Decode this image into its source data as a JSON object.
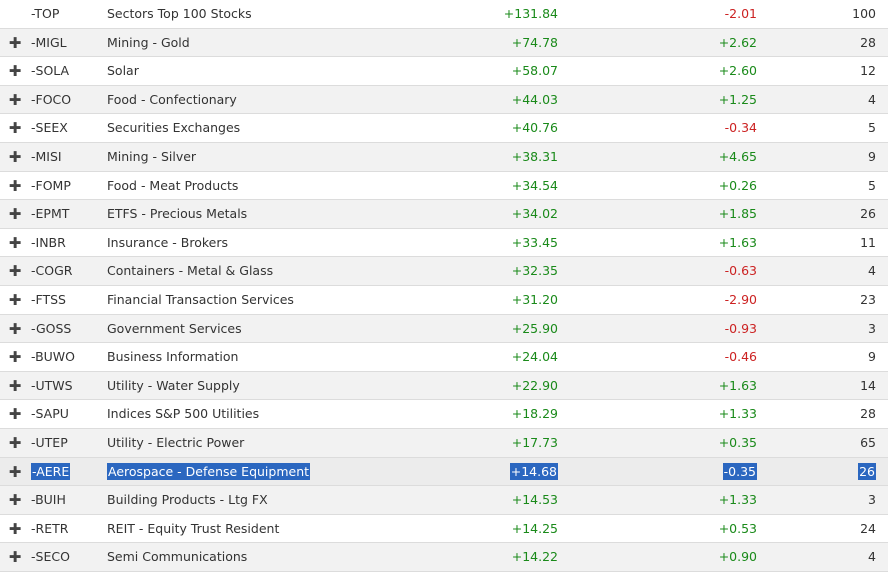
{
  "rows": [
    {
      "symbol": "-TOP",
      "name": "Sectors Top 100 Stocks",
      "change": "+131.84",
      "change2": "-2.01",
      "count": "100",
      "expand": false,
      "selected": false
    },
    {
      "symbol": "-MIGL",
      "name": "Mining - Gold",
      "change": "+74.78",
      "change2": "+2.62",
      "count": "28",
      "expand": true,
      "selected": false
    },
    {
      "symbol": "-SOLA",
      "name": "Solar",
      "change": "+58.07",
      "change2": "+2.60",
      "count": "12",
      "expand": true,
      "selected": false
    },
    {
      "symbol": "-FOCO",
      "name": "Food - Confectionary",
      "change": "+44.03",
      "change2": "+1.25",
      "count": "4",
      "expand": true,
      "selected": false
    },
    {
      "symbol": "-SEEX",
      "name": "Securities Exchanges",
      "change": "+40.76",
      "change2": "-0.34",
      "count": "5",
      "expand": true,
      "selected": false
    },
    {
      "symbol": "-MISI",
      "name": "Mining - Silver",
      "change": "+38.31",
      "change2": "+4.65",
      "count": "9",
      "expand": true,
      "selected": false
    },
    {
      "symbol": "-FOMP",
      "name": "Food - Meat Products",
      "change": "+34.54",
      "change2": "+0.26",
      "count": "5",
      "expand": true,
      "selected": false
    },
    {
      "symbol": "-EPMT",
      "name": "ETFS - Precious Metals",
      "change": "+34.02",
      "change2": "+1.85",
      "count": "26",
      "expand": true,
      "selected": false
    },
    {
      "symbol": "-INBR",
      "name": "Insurance - Brokers",
      "change": "+33.45",
      "change2": "+1.63",
      "count": "11",
      "expand": true,
      "selected": false
    },
    {
      "symbol": "-COGR",
      "name": "Containers - Metal & Glass",
      "change": "+32.35",
      "change2": "-0.63",
      "count": "4",
      "expand": true,
      "selected": false
    },
    {
      "symbol": "-FTSS",
      "name": "Financial Transaction Services",
      "change": "+31.20",
      "change2": "-2.90",
      "count": "23",
      "expand": true,
      "selected": false
    },
    {
      "symbol": "-GOSS",
      "name": "Government Services",
      "change": "+25.90",
      "change2": "-0.93",
      "count": "3",
      "expand": true,
      "selected": false
    },
    {
      "symbol": "-BUWO",
      "name": "Business Information",
      "change": "+24.04",
      "change2": "-0.46",
      "count": "9",
      "expand": true,
      "selected": false
    },
    {
      "symbol": "-UTWS",
      "name": "Utility - Water Supply",
      "change": "+22.90",
      "change2": "+1.63",
      "count": "14",
      "expand": true,
      "selected": false
    },
    {
      "symbol": "-SAPU",
      "name": "Indices S&P 500 Utilities",
      "change": "+18.29",
      "change2": "+1.33",
      "count": "28",
      "expand": true,
      "selected": false
    },
    {
      "symbol": "-UTEP",
      "name": "Utility - Electric Power",
      "change": "+17.73",
      "change2": "+0.35",
      "count": "65",
      "expand": true,
      "selected": false
    },
    {
      "symbol": "-AERE",
      "name": "Aerospace - Defense Equipment",
      "change": "+14.68",
      "change2": "-0.35",
      "count": "26",
      "expand": true,
      "selected": true
    },
    {
      "symbol": "-BUIH",
      "name": "Building Products - Ltg FX",
      "change": "+14.53",
      "change2": "+1.33",
      "count": "3",
      "expand": true,
      "selected": false
    },
    {
      "symbol": "-RETR",
      "name": "REIT - Equity Trust Resident",
      "change": "+14.25",
      "change2": "+0.53",
      "count": "24",
      "expand": true,
      "selected": false
    },
    {
      "symbol": "-SECO",
      "name": "Semi Communications",
      "change": "+14.22",
      "change2": "+0.90",
      "count": "4",
      "expand": true,
      "selected": false
    }
  ],
  "icons": {
    "expand": "plus-icon"
  },
  "colors": {
    "positive": "#1a8a1a",
    "negative": "#cc2222",
    "selection": "#2b67c0"
  }
}
